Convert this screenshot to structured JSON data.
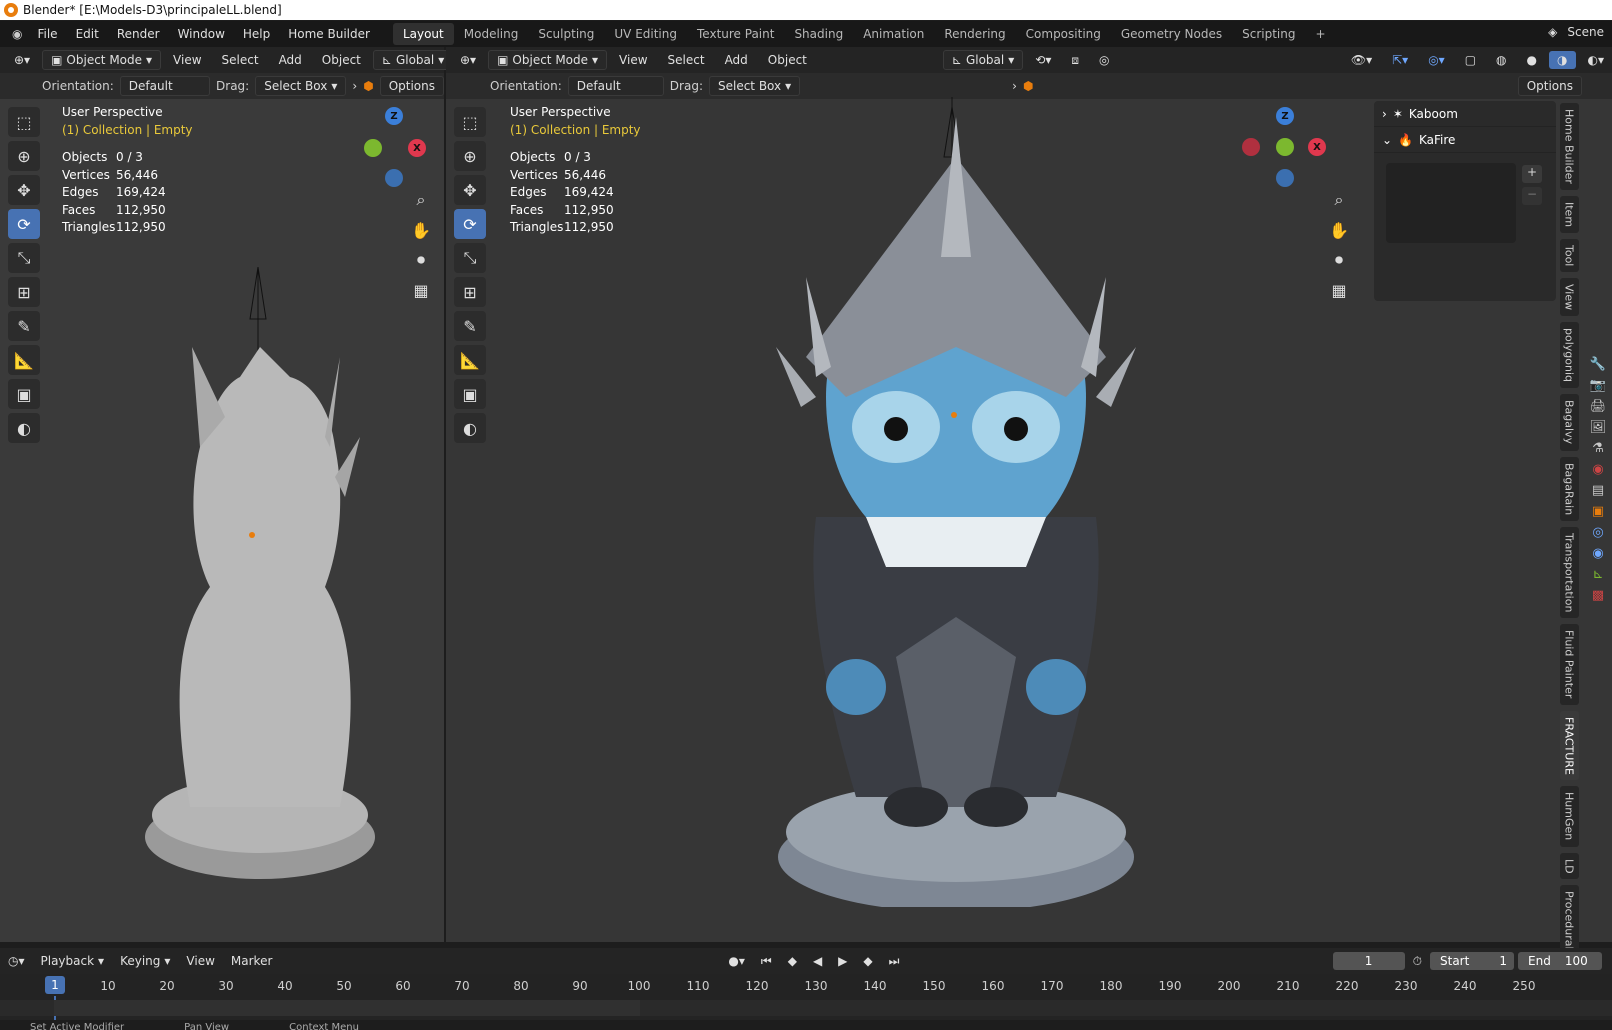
{
  "window": {
    "title": "Blender* [E:\\Models-D3\\principaleLL.blend]"
  },
  "topbar": {
    "menu": [
      "File",
      "Edit",
      "Render",
      "Window",
      "Help",
      "Home Builder"
    ],
    "workspaces": [
      "Layout",
      "Modeling",
      "Sculpting",
      "UV Editing",
      "Texture Paint",
      "Shading",
      "Animation",
      "Rendering",
      "Compositing",
      "Geometry Nodes",
      "Scripting"
    ],
    "scene": "Scene"
  },
  "viewport": {
    "mode": "Object Mode",
    "menus": [
      "View",
      "Select",
      "Add",
      "Object"
    ],
    "transform": "Global",
    "orientation_label": "Orientation:",
    "orientation": "Default",
    "drag_label": "Drag:",
    "drag": "Select Box",
    "options": "Options",
    "perspective": "User Perspective",
    "collection": "(1) Collection | Empty",
    "stats": [
      {
        "label": "Objects",
        "value": "0 / 3"
      },
      {
        "label": "Vertices",
        "value": "56,446"
      },
      {
        "label": "Edges",
        "value": "169,424"
      },
      {
        "label": "Faces",
        "value": "112,950"
      },
      {
        "label": "Triangles",
        "value": "112,950"
      }
    ],
    "axes": {
      "x": "X",
      "y": "Y",
      "z": "Z"
    }
  },
  "npanel": {
    "items": [
      "Kaboom",
      "KaFire"
    ]
  },
  "sidetabs": [
    "Home Builder",
    "Item",
    "Tool",
    "View",
    "polygoniq",
    "Bagalvy",
    "BagaRain",
    "Transportation",
    "Fluid Painter",
    "FRACTURE",
    "HumGen",
    "LD",
    "Procedural Cr"
  ],
  "timeline": {
    "menus": [
      "Playback",
      "Keying",
      "View",
      "Marker"
    ],
    "current_frame": "1",
    "start_label": "Start",
    "start": "1",
    "end_label": "End",
    "end": "100",
    "ticks": [
      "1",
      "10",
      "20",
      "30",
      "40",
      "50",
      "60",
      "70",
      "80",
      "90",
      "100",
      "110",
      "120",
      "130",
      "140",
      "150",
      "160",
      "170",
      "180",
      "190",
      "200",
      "210",
      "220",
      "230",
      "240",
      "250"
    ]
  },
  "status": [
    "Set Active Modifier",
    "Pan View",
    "Context Menu"
  ],
  "colors": {
    "accent": "#4772b3",
    "x_axis": "#e0384e",
    "y_axis": "#7cb82f",
    "z_axis": "#3b7fd9",
    "collection_text": "#e9c93a"
  }
}
